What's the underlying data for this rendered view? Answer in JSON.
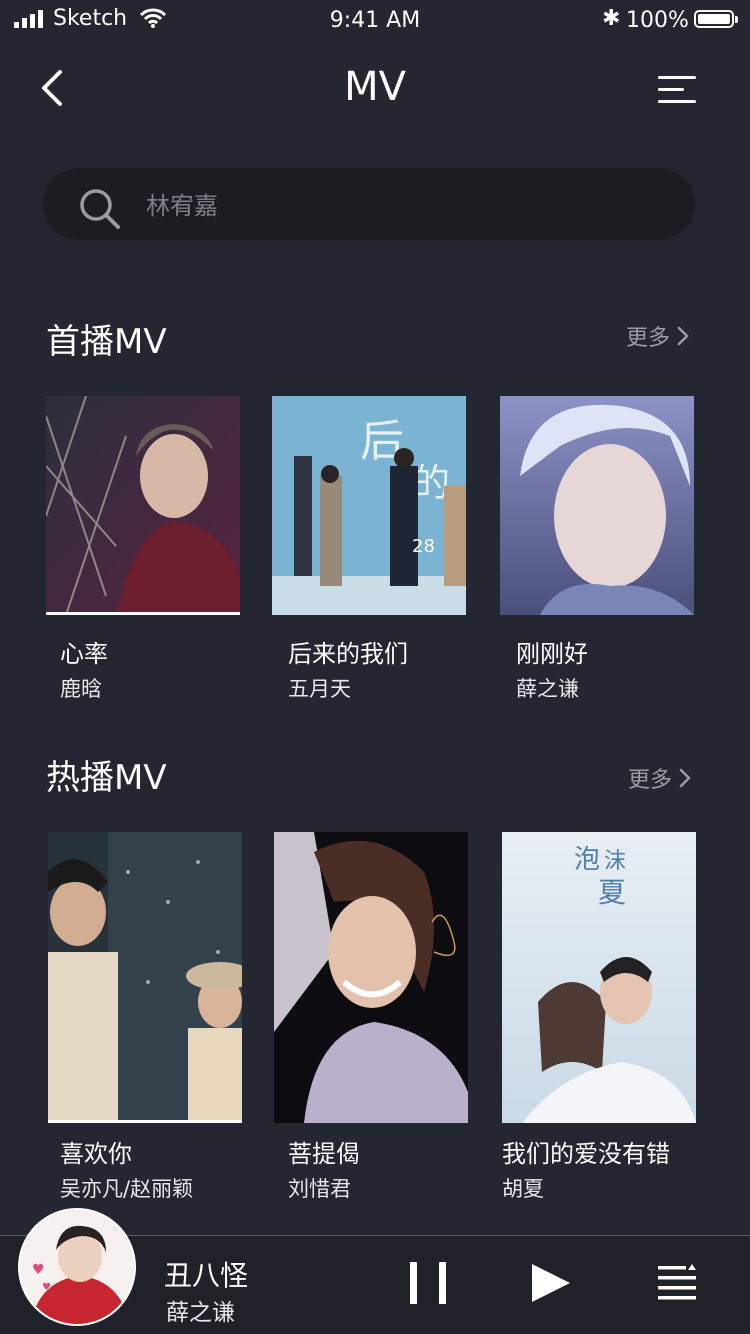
{
  "status_bar": {
    "carrier": "Sketch",
    "time": "9:41 AM",
    "battery": "100%",
    "icons": [
      "signal-icon",
      "wifi-icon",
      "bluetooth-icon",
      "battery-icon"
    ]
  },
  "nav": {
    "title": "MV",
    "back_icon": "chevron-left-icon",
    "menu_icon": "menu-icon"
  },
  "search": {
    "placeholder": "林宥嘉",
    "icon": "search-icon"
  },
  "sections": [
    {
      "title": "首播MV",
      "more": "更多",
      "items": [
        {
          "title": "心率",
          "artist": "鹿晗"
        },
        {
          "title": "后来的我们",
          "artist": "五月天"
        },
        {
          "title": "刚刚好",
          "artist": "薛之谦"
        }
      ]
    },
    {
      "title": "热播MV",
      "more": "更多",
      "items": [
        {
          "title": "喜欢你",
          "artist": "吴亦凡/赵丽颖"
        },
        {
          "title": "菩提偈",
          "artist": "刘惜君"
        },
        {
          "title": "我们的爱没有错",
          "artist": "胡夏"
        }
      ]
    }
  ],
  "now_playing": {
    "title": "丑八怪",
    "artist": "薛之谦",
    "controls": [
      "pause-icon",
      "play-icon",
      "playlist-icon"
    ]
  },
  "colors": {
    "background": "#242732",
    "search_bg": "#1b1d23",
    "player_bg": "#1f2229",
    "muted_text": "#9a9ca4"
  }
}
